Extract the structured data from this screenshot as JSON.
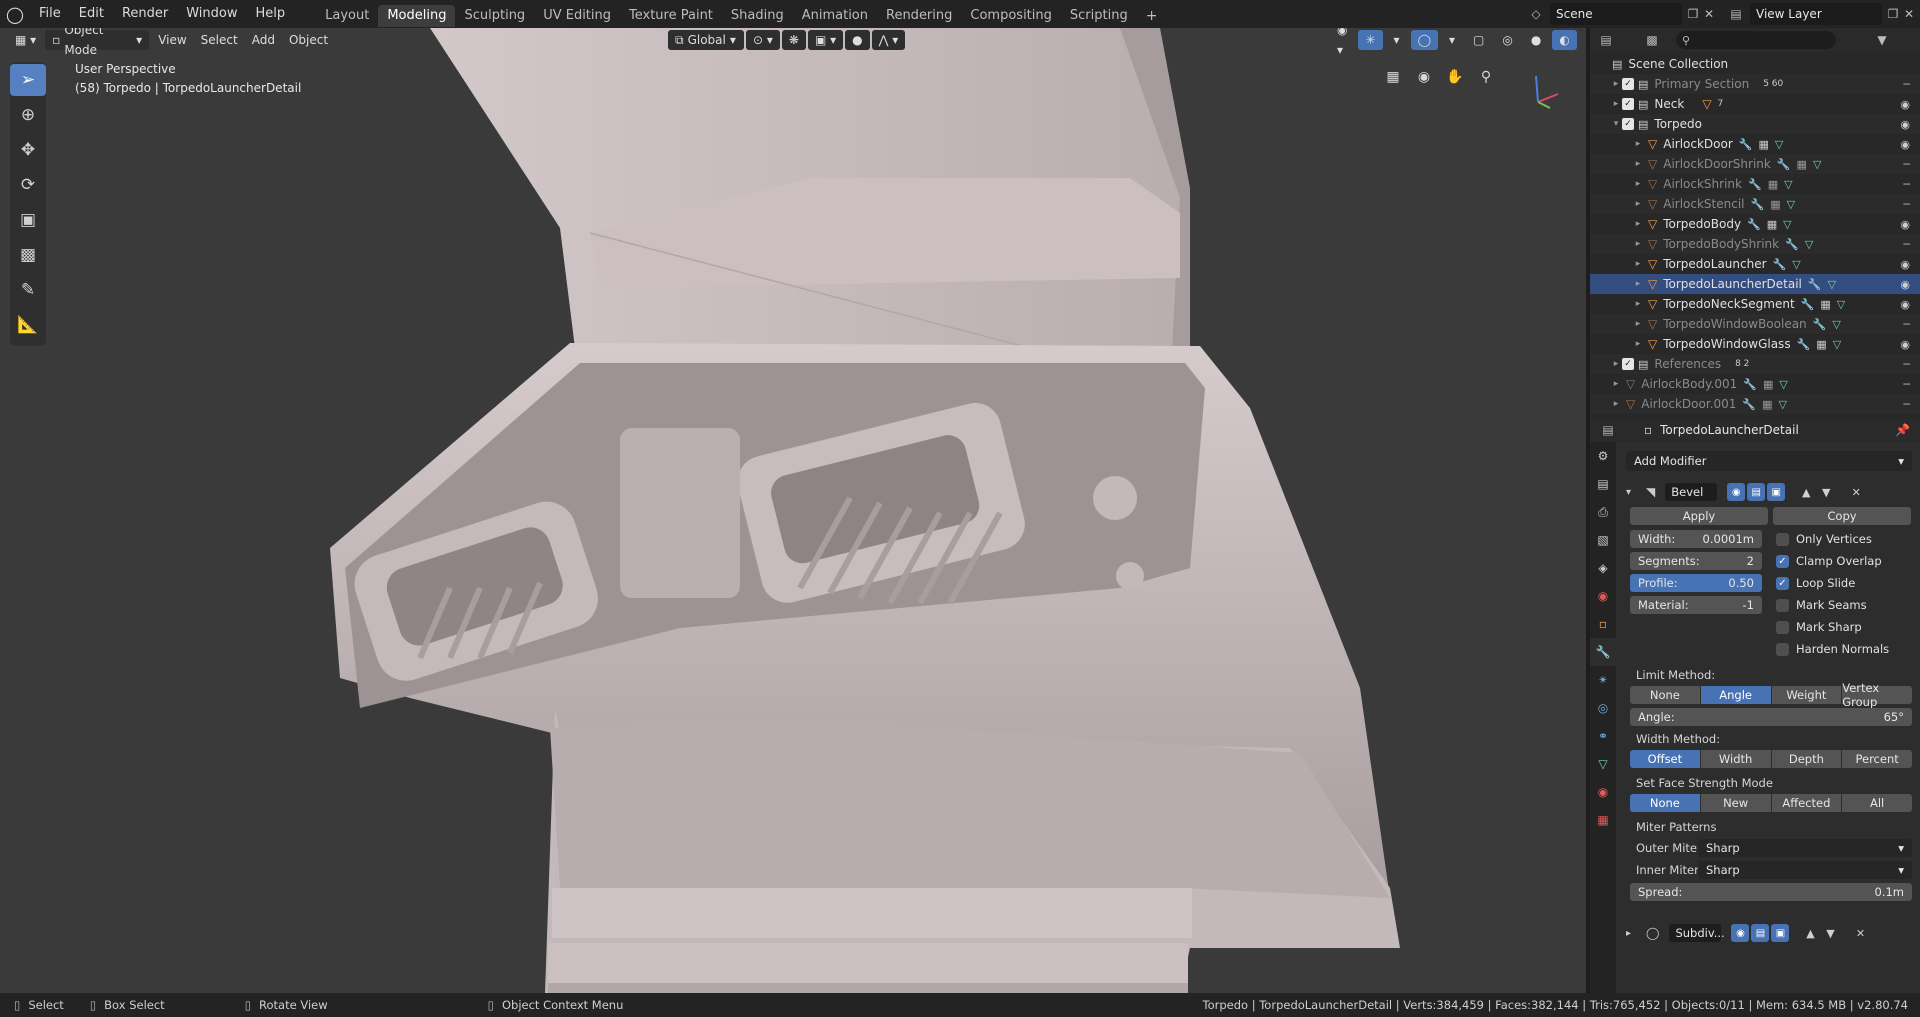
{
  "menu": [
    "File",
    "Edit",
    "Render",
    "Window",
    "Help"
  ],
  "workspaces": [
    "Layout",
    "Modeling",
    "Sculpting",
    "UV Editing",
    "Texture Paint",
    "Shading",
    "Animation",
    "Rendering",
    "Compositing",
    "Scripting"
  ],
  "active_workspace": "Modeling",
  "scene_name": "Scene",
  "view_layer": "View Layer",
  "viewport": {
    "mode": "Object Mode",
    "menus": [
      "View",
      "Select",
      "Add",
      "Object"
    ],
    "orientation": "Global",
    "perspective": "User Perspective",
    "object_info": "(58) Torpedo | TorpedoLauncherDetail"
  },
  "outliner": {
    "search_placeholder": "",
    "rows": [
      {
        "name": "Scene Collection"
      },
      {
        "name": "Primary Section",
        "counts": "5   60"
      },
      {
        "name": "Neck",
        "counts": "7"
      },
      {
        "name": "Torpedo"
      },
      {
        "name": "AirlockDoor"
      },
      {
        "name": "AirlockDoorShrink"
      },
      {
        "name": "AirlockShrink"
      },
      {
        "name": "AirlockStencil"
      },
      {
        "name": "TorpedoBody"
      },
      {
        "name": "TorpedoBodyShrink"
      },
      {
        "name": "TorpedoLauncher"
      },
      {
        "name": "TorpedoLauncherDetail"
      },
      {
        "name": "TorpedoNeckSegment"
      },
      {
        "name": "TorpedoWindowBoolean"
      },
      {
        "name": "TorpedoWindowGlass"
      },
      {
        "name": "References",
        "counts": "8   2"
      },
      {
        "name": "AirlockBody.001"
      },
      {
        "name": "AirlockDoor.001"
      }
    ]
  },
  "properties": {
    "object_name": "TorpedoLauncherDetail",
    "add_modifier": "Add Modifier",
    "modifier1": {
      "name": "Bevel",
      "apply": "Apply",
      "copy": "Copy",
      "width_label": "Width:",
      "width": "0.0001m",
      "segments_label": "Segments:",
      "segments": "2",
      "profile_label": "Profile:",
      "profile": "0.50",
      "material_label": "Material:",
      "material": "-1",
      "checkboxes": [
        {
          "label": "Only Vertices",
          "checked": false
        },
        {
          "label": "Clamp Overlap",
          "checked": true
        },
        {
          "label": "Loop Slide",
          "checked": true
        },
        {
          "label": "Mark Seams",
          "checked": false
        },
        {
          "label": "Mark Sharp",
          "checked": false
        },
        {
          "label": "Harden Normals",
          "checked": false
        }
      ],
      "limit_method_label": "Limit Method:",
      "limit_method": [
        "None",
        "Angle",
        "Weight",
        "Vertex Group"
      ],
      "angle_label": "Angle:",
      "angle": "65°",
      "width_method_label": "Width Method:",
      "width_method": [
        "Offset",
        "Width",
        "Depth",
        "Percent"
      ],
      "face_strength_label": "Set Face Strength Mode",
      "face_strength": [
        "None",
        "New",
        "Affected",
        "All"
      ],
      "miter_label": "Miter Patterns",
      "outer_miter_label": "Outer Miter:",
      "outer_miter": "Sharp",
      "inner_miter_label": "Inner Miter:",
      "inner_miter": "Sharp",
      "spread_label": "Spread:",
      "spread": "0.1m"
    },
    "modifier2": {
      "name": "Subdiv..."
    }
  },
  "status": {
    "select": "Select",
    "box_select": "Box Select",
    "rotate_view": "Rotate View",
    "context_menu": "Object Context Menu",
    "stats": "Torpedo | TorpedoLauncherDetail | Verts:384,459 | Faces:382,144 | Tris:765,452 | Objects:0/11 | Mem: 634.5 MB | v2.80.74"
  },
  "colors": {
    "accent": "#4772b3",
    "selection": "#334d80",
    "object_icon": "#f29d49"
  }
}
